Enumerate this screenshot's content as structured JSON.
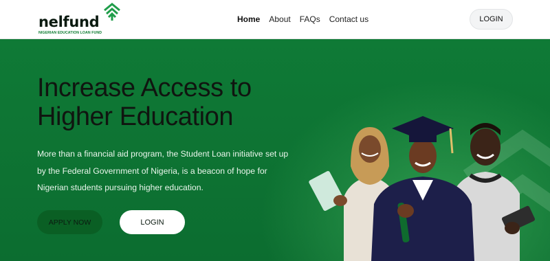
{
  "brand": {
    "name": "nelfund",
    "tagline": "NIGERIAN EDUCATION LOAN FUND"
  },
  "nav": {
    "items": [
      "Home",
      "About",
      "FAQs",
      "Contact us"
    ],
    "active": "Home",
    "login_label": "LOGIN"
  },
  "hero": {
    "title": "Increase Access to Higher Education",
    "description": "More than a financial aid program, the Student Loan initiative set up by the Federal Government of Nigeria, is a beacon of hope for Nigerian students pursuing higher education.",
    "apply_label": "APPLY NOW",
    "login_label": "LOGIN"
  },
  "colors": {
    "hero_green": "#0f7a36",
    "apply_button": "#0a5f24",
    "brand_accent": "#1f9d4a"
  },
  "icons": [
    "nelfund-logo-chevron-icon"
  ]
}
